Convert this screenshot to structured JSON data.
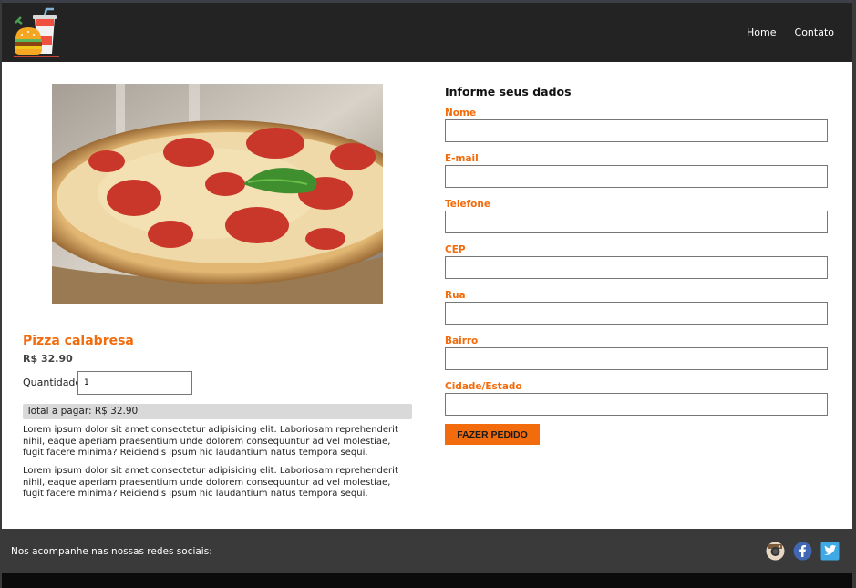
{
  "nav": {
    "home_label": "Home",
    "contact_label": "Contato"
  },
  "product": {
    "title": "Pizza calabresa",
    "price": "R$ 32.90",
    "quantity_label": "Quantidade",
    "quantity_value": "1",
    "total": "Total a pagar: R$ 32.90",
    "description_1": "Lorem ipsum dolor sit amet consectetur adipisicing elit. Laboriosam reprehenderit nihil, eaque aperiam praesentium unde dolorem consequuntur ad vel molestiae, fugit facere minima? Reiciendis ipsum hic laudantium natus tempora sequi.",
    "description_2": "Lorem ipsum dolor sit amet consectetur adipisicing elit. Laboriosam reprehenderit nihil, eaque aperiam praesentium unde dolorem consequuntur ad vel molestiae, fugit facere minima? Reiciendis ipsum hic laudantium natus tempora sequi."
  },
  "form": {
    "title": "Informe seus dados",
    "fields": [
      {
        "label": "Nome",
        "value": ""
      },
      {
        "label": "E-mail",
        "value": ""
      },
      {
        "label": "Telefone",
        "value": ""
      },
      {
        "label": "CEP",
        "value": ""
      },
      {
        "label": "Rua",
        "value": ""
      },
      {
        "label": "Bairro",
        "value": ""
      },
      {
        "label": "Cidade/Estado",
        "value": ""
      }
    ],
    "submit_label": "FAZER PEDIDO"
  },
  "footer": {
    "text": "Nos acompanhe nas nossas redes sociais:",
    "social_icons": [
      "instagram-icon",
      "facebook-icon",
      "twitter-icon"
    ]
  },
  "colors": {
    "accent": "#f26b0c",
    "header_bg": "#232323",
    "footer_bg": "#3a3a3a",
    "total_bg": "#d9d9d9"
  }
}
